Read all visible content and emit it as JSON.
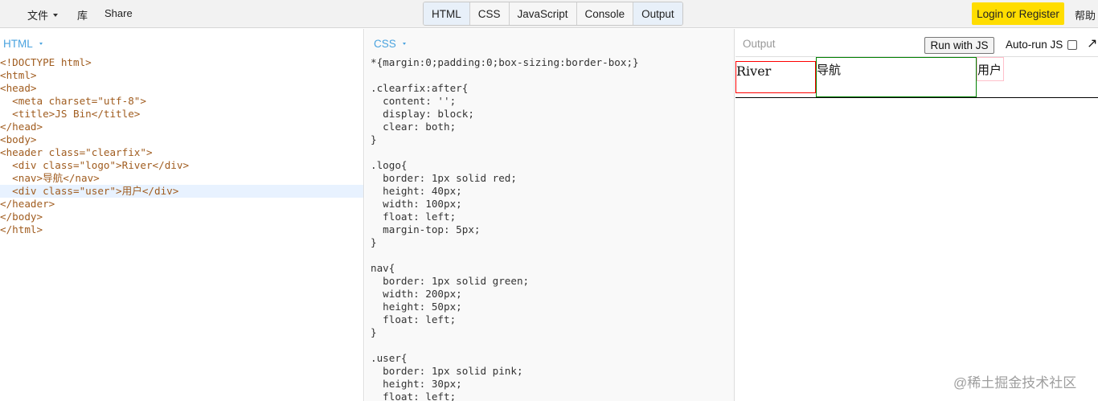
{
  "topbar": {
    "file_label": "文件",
    "library_label": "库",
    "share_label": "Share",
    "toggles": [
      "HTML",
      "CSS",
      "JavaScript",
      "Console",
      "Output"
    ],
    "login_label": "Login or Register",
    "help_label": "帮助"
  },
  "html_panel": {
    "label": "HTML",
    "lines": [
      "<!DOCTYPE html>",
      "<html>",
      "<head>",
      "  <meta charset=\"utf-8\">",
      "  <title>JS Bin</title>",
      "</head>",
      "<body>",
      "<header class=\"clearfix\">",
      "  <div class=\"logo\">River</div>",
      "  <nav>导航</nav>",
      "  <div class=\"user\">用户</div>",
      "</header>",
      "</body>",
      "</html>"
    ]
  },
  "css_panel": {
    "label": "CSS",
    "lines": [
      "*{margin:0;padding:0;box-sizing:border-box;}",
      "",
      ".clearfix:after{",
      "  content: '';",
      "  display: block;",
      "  clear: both;",
      "}",
      "",
      ".logo{",
      "  border: 1px solid red;",
      "  height: 40px;",
      "  width: 100px;",
      "  float: left;",
      "  margin-top: 5px;",
      "}",
      "",
      "nav{",
      "  border: 1px solid green;",
      "  width: 200px;",
      "  height: 50px;",
      "  float: left;",
      "}",
      "",
      ".user{",
      "  border: 1px solid pink;",
      "  height: 30px;",
      "  float: left;"
    ]
  },
  "output_panel": {
    "label": "Output",
    "run_label": "Run with JS",
    "autorun_label": "Auto-run JS",
    "popout_glyph": "↗",
    "logo_text": "River",
    "nav_text": "导航",
    "user_text": "用户"
  },
  "watermark": "@稀土掘金技术社区"
}
